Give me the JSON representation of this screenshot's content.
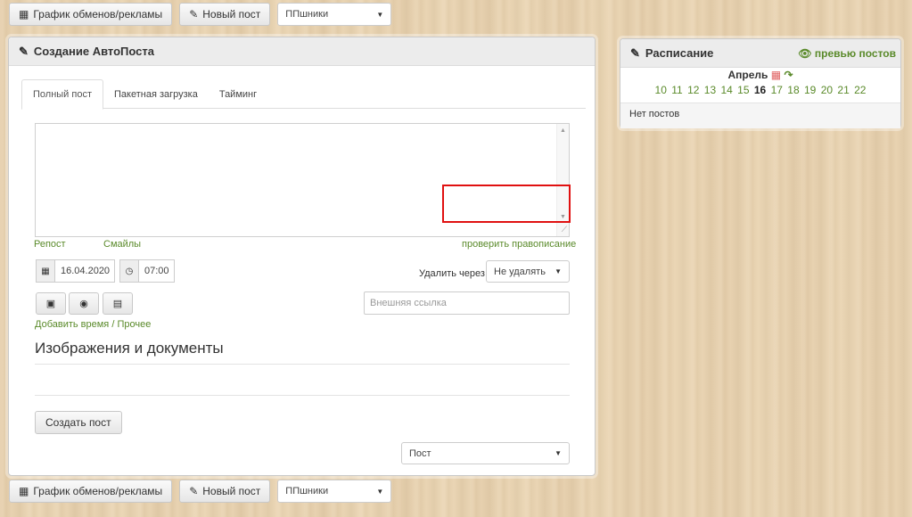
{
  "toolbar": {
    "schedule_button": "График обменов/рекламы",
    "new_post_button": "Новый пост",
    "group_select": "ППшники"
  },
  "editor": {
    "title": "Создание АвтоПоста",
    "tabs": [
      "Полный пост",
      "Пакетная загрузка",
      "Тайминг"
    ],
    "textarea_value": "",
    "repost_link": "Репост",
    "smiles_link": "Смайлы",
    "spellcheck_link": "проверить правописание",
    "date": "16.04.2020",
    "time": "07:00",
    "delete_label": "Удалить через:",
    "delete_select": "Не удалять",
    "external_link_placeholder": "Внешняя ссылка",
    "add_time_link": "Добавить время",
    "separator": " / ",
    "other_link": "Прочее",
    "images_heading": "Изображения и документы",
    "create_button": "Создать пост",
    "type_select": "Пост"
  },
  "schedule": {
    "title": "Расписание",
    "preview_link": "превью постов",
    "month": "Апрель",
    "days": [
      "10",
      "11",
      "12",
      "13",
      "14",
      "15",
      "16",
      "17",
      "18",
      "19",
      "20",
      "21",
      "22"
    ],
    "current_day": "16",
    "empty_text": "Нет постов"
  },
  "icons": {
    "calendar": "calendar-icon",
    "pencil": "pencil-icon",
    "clock": "clock-icon",
    "image": "image-icon",
    "globe": "globe-icon",
    "film": "film-icon",
    "eye": "eye-icon",
    "share": "share-arrow-icon"
  },
  "colors": {
    "link_green": "#5a8a2a",
    "highlight_red": "#e01010"
  }
}
